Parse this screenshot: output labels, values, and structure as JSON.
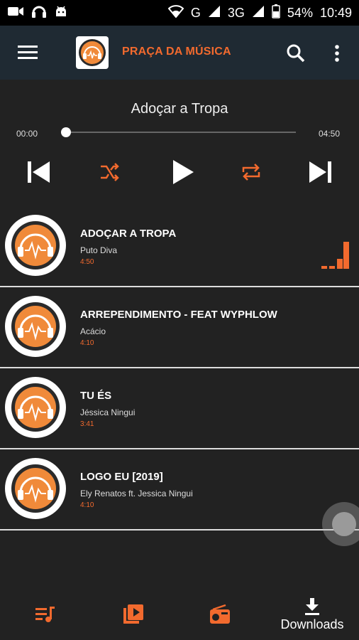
{
  "status_bar": {
    "battery": "54%",
    "time": "10:49",
    "network_g": "G",
    "network_3g": "3G"
  },
  "app_bar": {
    "title": "PRAÇA DA MÚSICA",
    "menu_icon": "menu-icon",
    "search_icon": "search-icon",
    "more_icon": "more-vert-icon"
  },
  "player": {
    "now_playing": "Adoçar a Tropa",
    "elapsed": "00:00",
    "total": "04:50",
    "progress": 0
  },
  "songs": [
    {
      "title": "ADOÇAR A TROPA",
      "artist": "Puto Diva",
      "duration": "4:50",
      "playing": true
    },
    {
      "title": " ARREPENDIMENTO - FEAT WYPHLOW",
      "artist": "Acácio",
      "duration": "4:10",
      "playing": false
    },
    {
      "title": "TU ÉS",
      "artist": "Jéssica Ningui",
      "duration": "3:41",
      "playing": false
    },
    {
      "title": "LOGO EU [2019]",
      "artist": "Ely Renatos ft. Jessica Ningui",
      "duration": "4:10",
      "playing": false
    }
  ],
  "bottom_nav": {
    "downloads_label": "Downloads"
  },
  "colors": {
    "accent": "#f26a2e",
    "appbar": "#1f2a33",
    "background": "#222222"
  }
}
